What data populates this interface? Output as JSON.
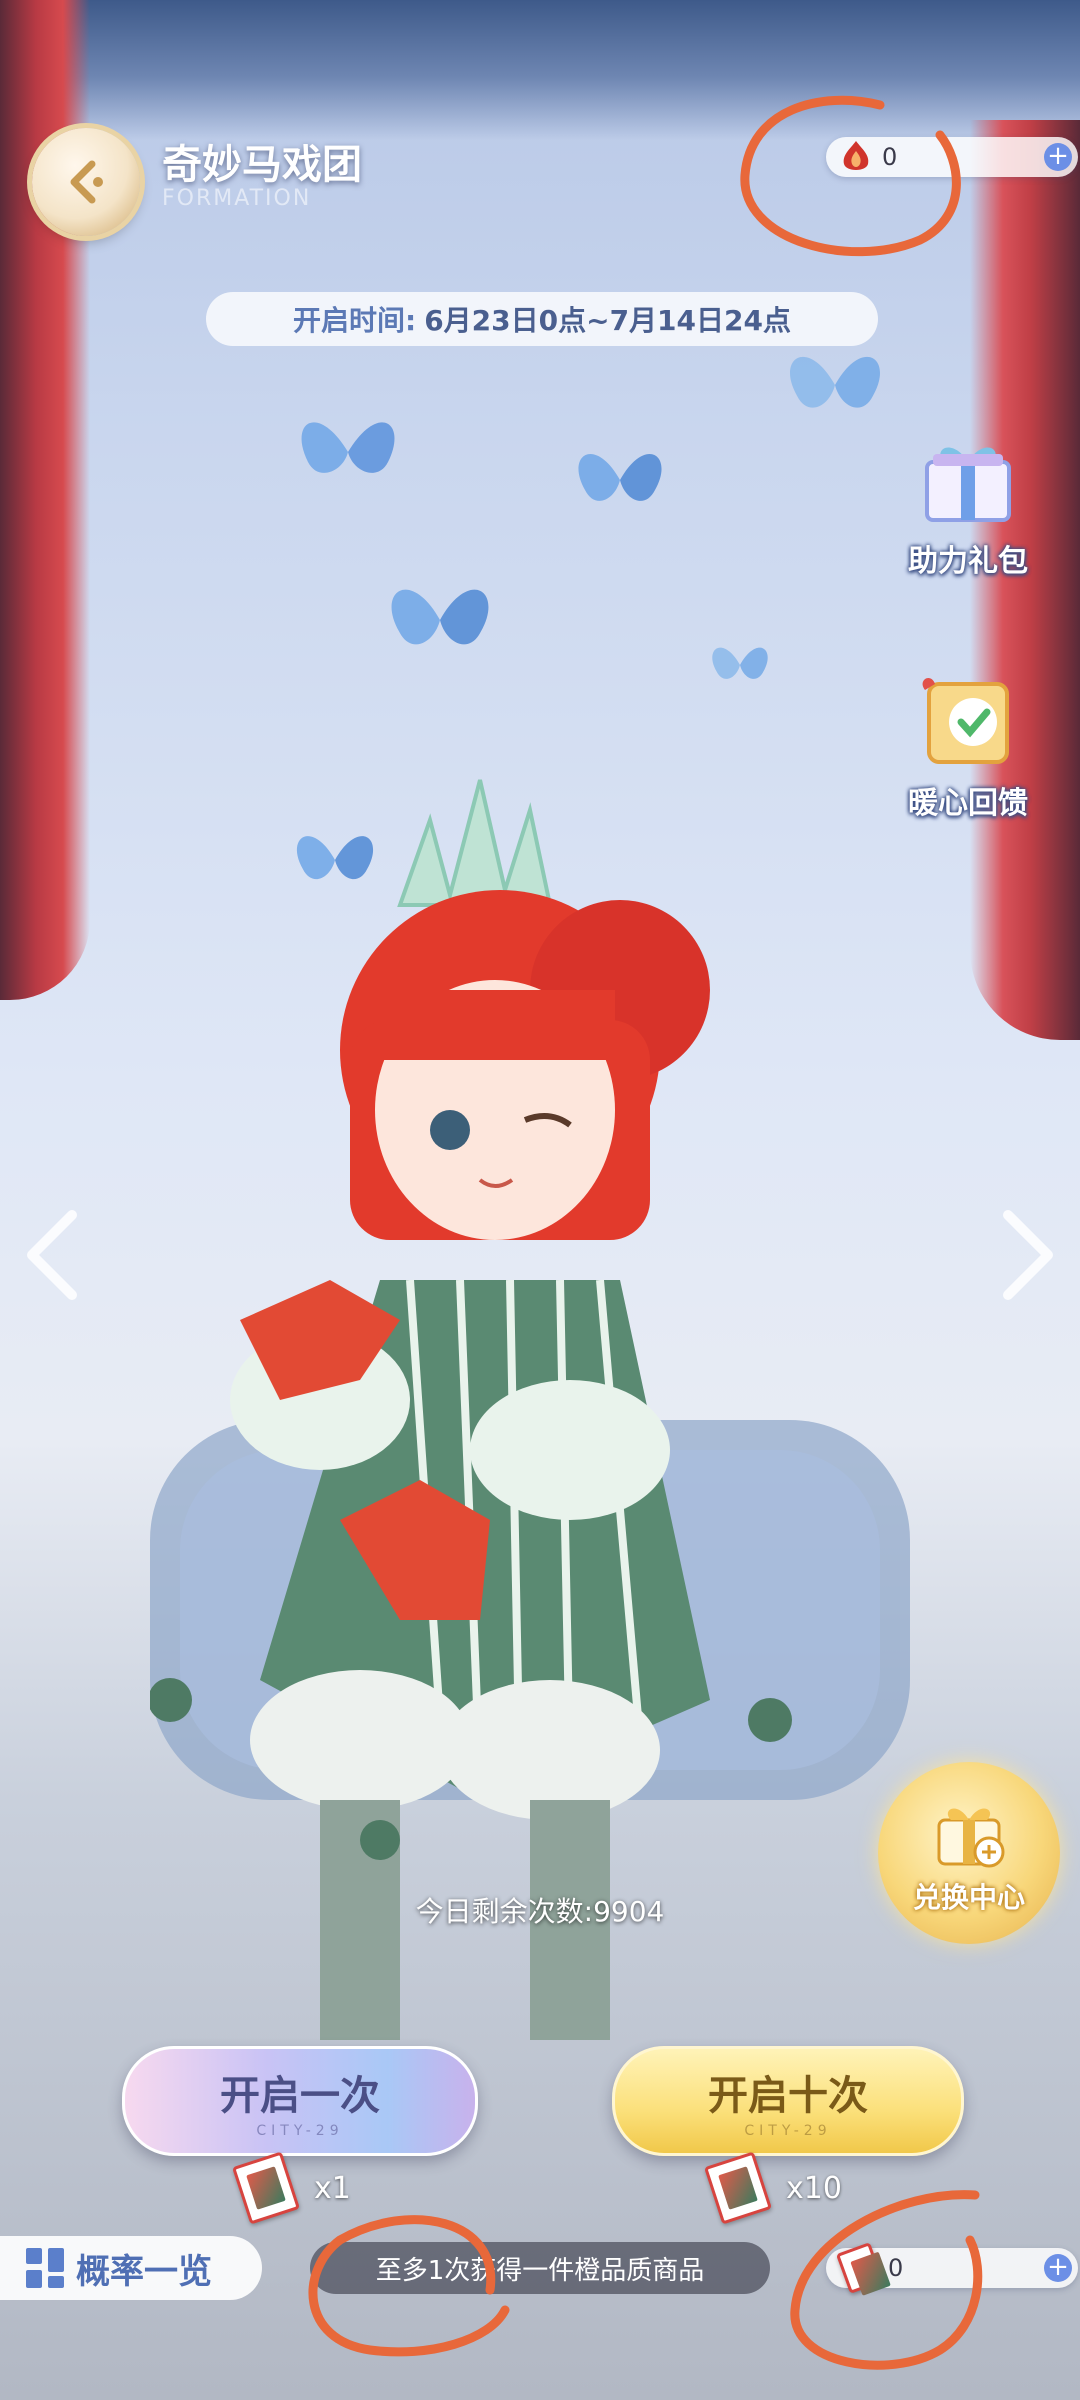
{
  "header": {
    "title": "奇妙马戏团",
    "subtitle": "FORMATION",
    "back_icon": "back-arrow-icon"
  },
  "currency_top": {
    "icon": "flame-gem-icon",
    "value": "0",
    "add_icon": "plus-icon"
  },
  "open_time": {
    "label": "开启时间:",
    "value": "6月23日0点~7月14日24点"
  },
  "side_entries": [
    {
      "label": "助力礼包",
      "icon": "gift-box-icon"
    },
    {
      "label": "暖心回馈",
      "icon": "check-bag-icon"
    }
  ],
  "exchange": {
    "label": "兑换中心",
    "icon": "gift-exchange-icon"
  },
  "remaining": {
    "text": "今日剩余次数:9904"
  },
  "draw_buttons": [
    {
      "label": "开启一次",
      "sub": "CITY-29",
      "cost": "x1",
      "cost_icon": "ticket-icon"
    },
    {
      "label": "开启十次",
      "sub": "CITY-29",
      "cost": "x10",
      "cost_icon": "ticket-icon"
    }
  ],
  "probability": {
    "label": "概率一览",
    "icon": "grid-icon"
  },
  "guarantee": {
    "text": "至多1次获得一件橙品质商品"
  },
  "currency_bottom": {
    "icon": "ticket-icon",
    "value": "0",
    "add_icon": "plus-icon"
  },
  "colors": {
    "annotation": "#e8683a",
    "accent_blue": "#6c8fe6",
    "gold": "#f1c84a"
  }
}
